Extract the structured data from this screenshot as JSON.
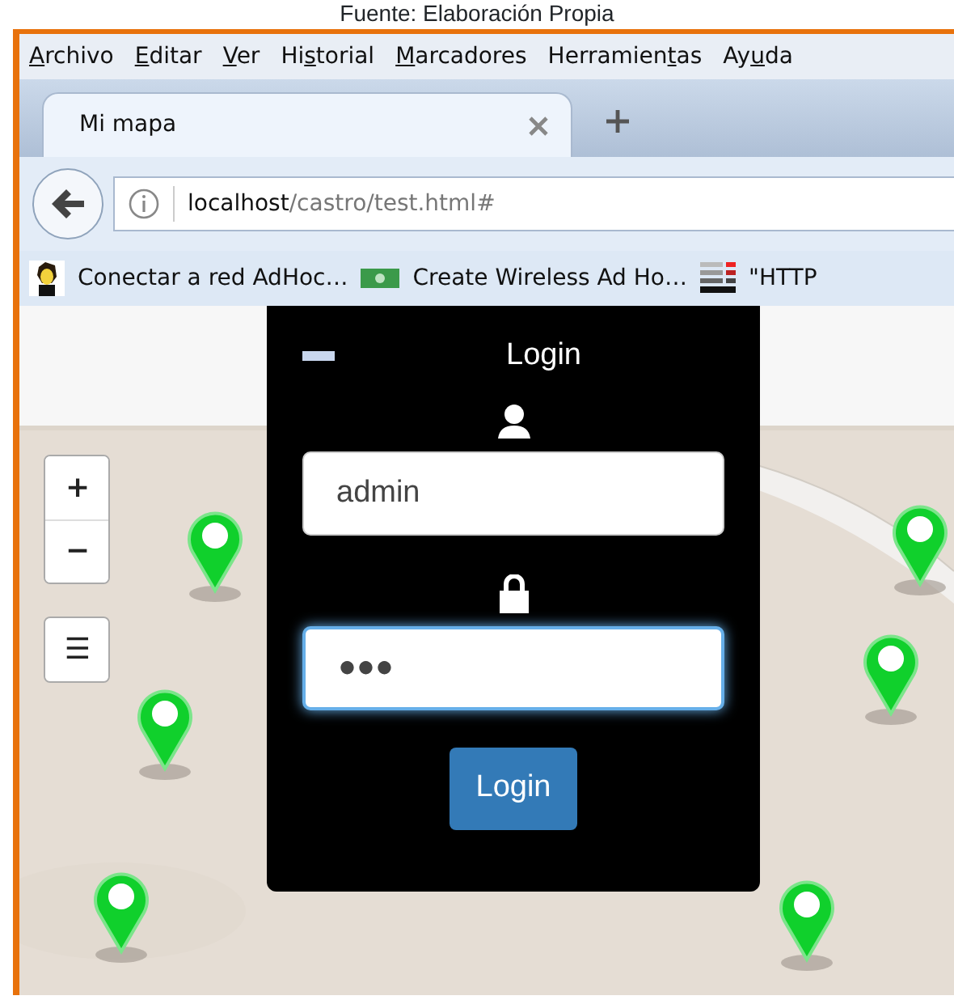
{
  "caption": "Fuente: Elaboración Propia",
  "menu_bar": [
    {
      "key": "A",
      "post": "rchivo"
    },
    {
      "key": "E",
      "post": "ditar"
    },
    {
      "key": "V",
      "post": "er"
    },
    {
      "pre": "Hi",
      "key": "s",
      "post": "torial"
    },
    {
      "key": "M",
      "post": "arcadores"
    },
    {
      "pre": "Herramien",
      "key": "t",
      "post": "as"
    },
    {
      "pre": "Ay",
      "key": "u",
      "post": "da"
    }
  ],
  "tabs": [
    {
      "title": "Mi mapa",
      "selected": true
    }
  ],
  "address_bar": {
    "host": "localhost",
    "path": "/castro/test.html#"
  },
  "bookmarks": [
    {
      "label": "Conectar a red AdHoc…"
    },
    {
      "label": "Create Wireless Ad Ho…"
    },
    {
      "label": "\"HTTP"
    }
  ],
  "map_controls": {
    "zoom_in": "+",
    "zoom_out": "−",
    "layers": "☰"
  },
  "login_panel": {
    "title": "Login",
    "username": {
      "value": "admin",
      "focused": false
    },
    "password": {
      "value": "●●●",
      "focused": true
    },
    "button": "Login"
  }
}
